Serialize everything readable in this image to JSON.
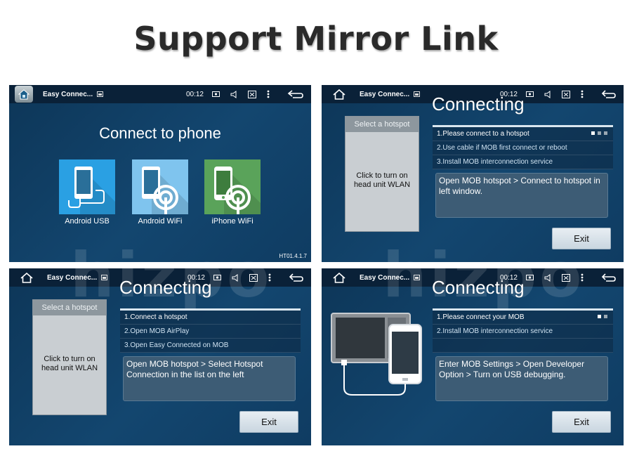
{
  "title": "Support Mirror Link",
  "watermark": "hizpo",
  "status": {
    "app_title": "Easy Connec...",
    "time": "00:12"
  },
  "screen1": {
    "heading": "Connect to phone",
    "options": [
      {
        "label": "Android USB",
        "color": "#2aa0e3"
      },
      {
        "label": "Android WiFi",
        "color": "#7fc4ee"
      },
      {
        "label": "iPhone WiFi",
        "color": "#5aa35a"
      }
    ],
    "version": "HT01.4.1.7"
  },
  "screen2": {
    "title": "Connecting",
    "hotspot_header": "Select a hotspot",
    "hotspot_body": "Click to turn on head unit WLAN",
    "steps": [
      "1.Please connect to a hotspot",
      "2.Use cable if MOB first connect or reboot",
      "3.Install MOB interconnection service"
    ],
    "info": "Open MOB hotspot > Connect to hotspot in left window.",
    "exit_label": "Exit"
  },
  "screen3": {
    "title": "Connecting",
    "hotspot_header": "Select a hotspot",
    "hotspot_body": "Click to turn on head unit WLAN",
    "steps": [
      "1.Connect a hotspot",
      "2.Open MOB AirPlay",
      "3.Open Easy Connected on MOB"
    ],
    "info": "Open MOB hotspot > Select Hotspot Connection in the list on the left",
    "exit_label": "Exit"
  },
  "screen4": {
    "title": "Connecting",
    "steps": [
      "1.Please connect your MOB",
      "2.Install MOB interconnection service"
    ],
    "info": "Enter MOB Settings > Open Developer Option > Turn on USB debugging.",
    "exit_label": "Exit"
  }
}
